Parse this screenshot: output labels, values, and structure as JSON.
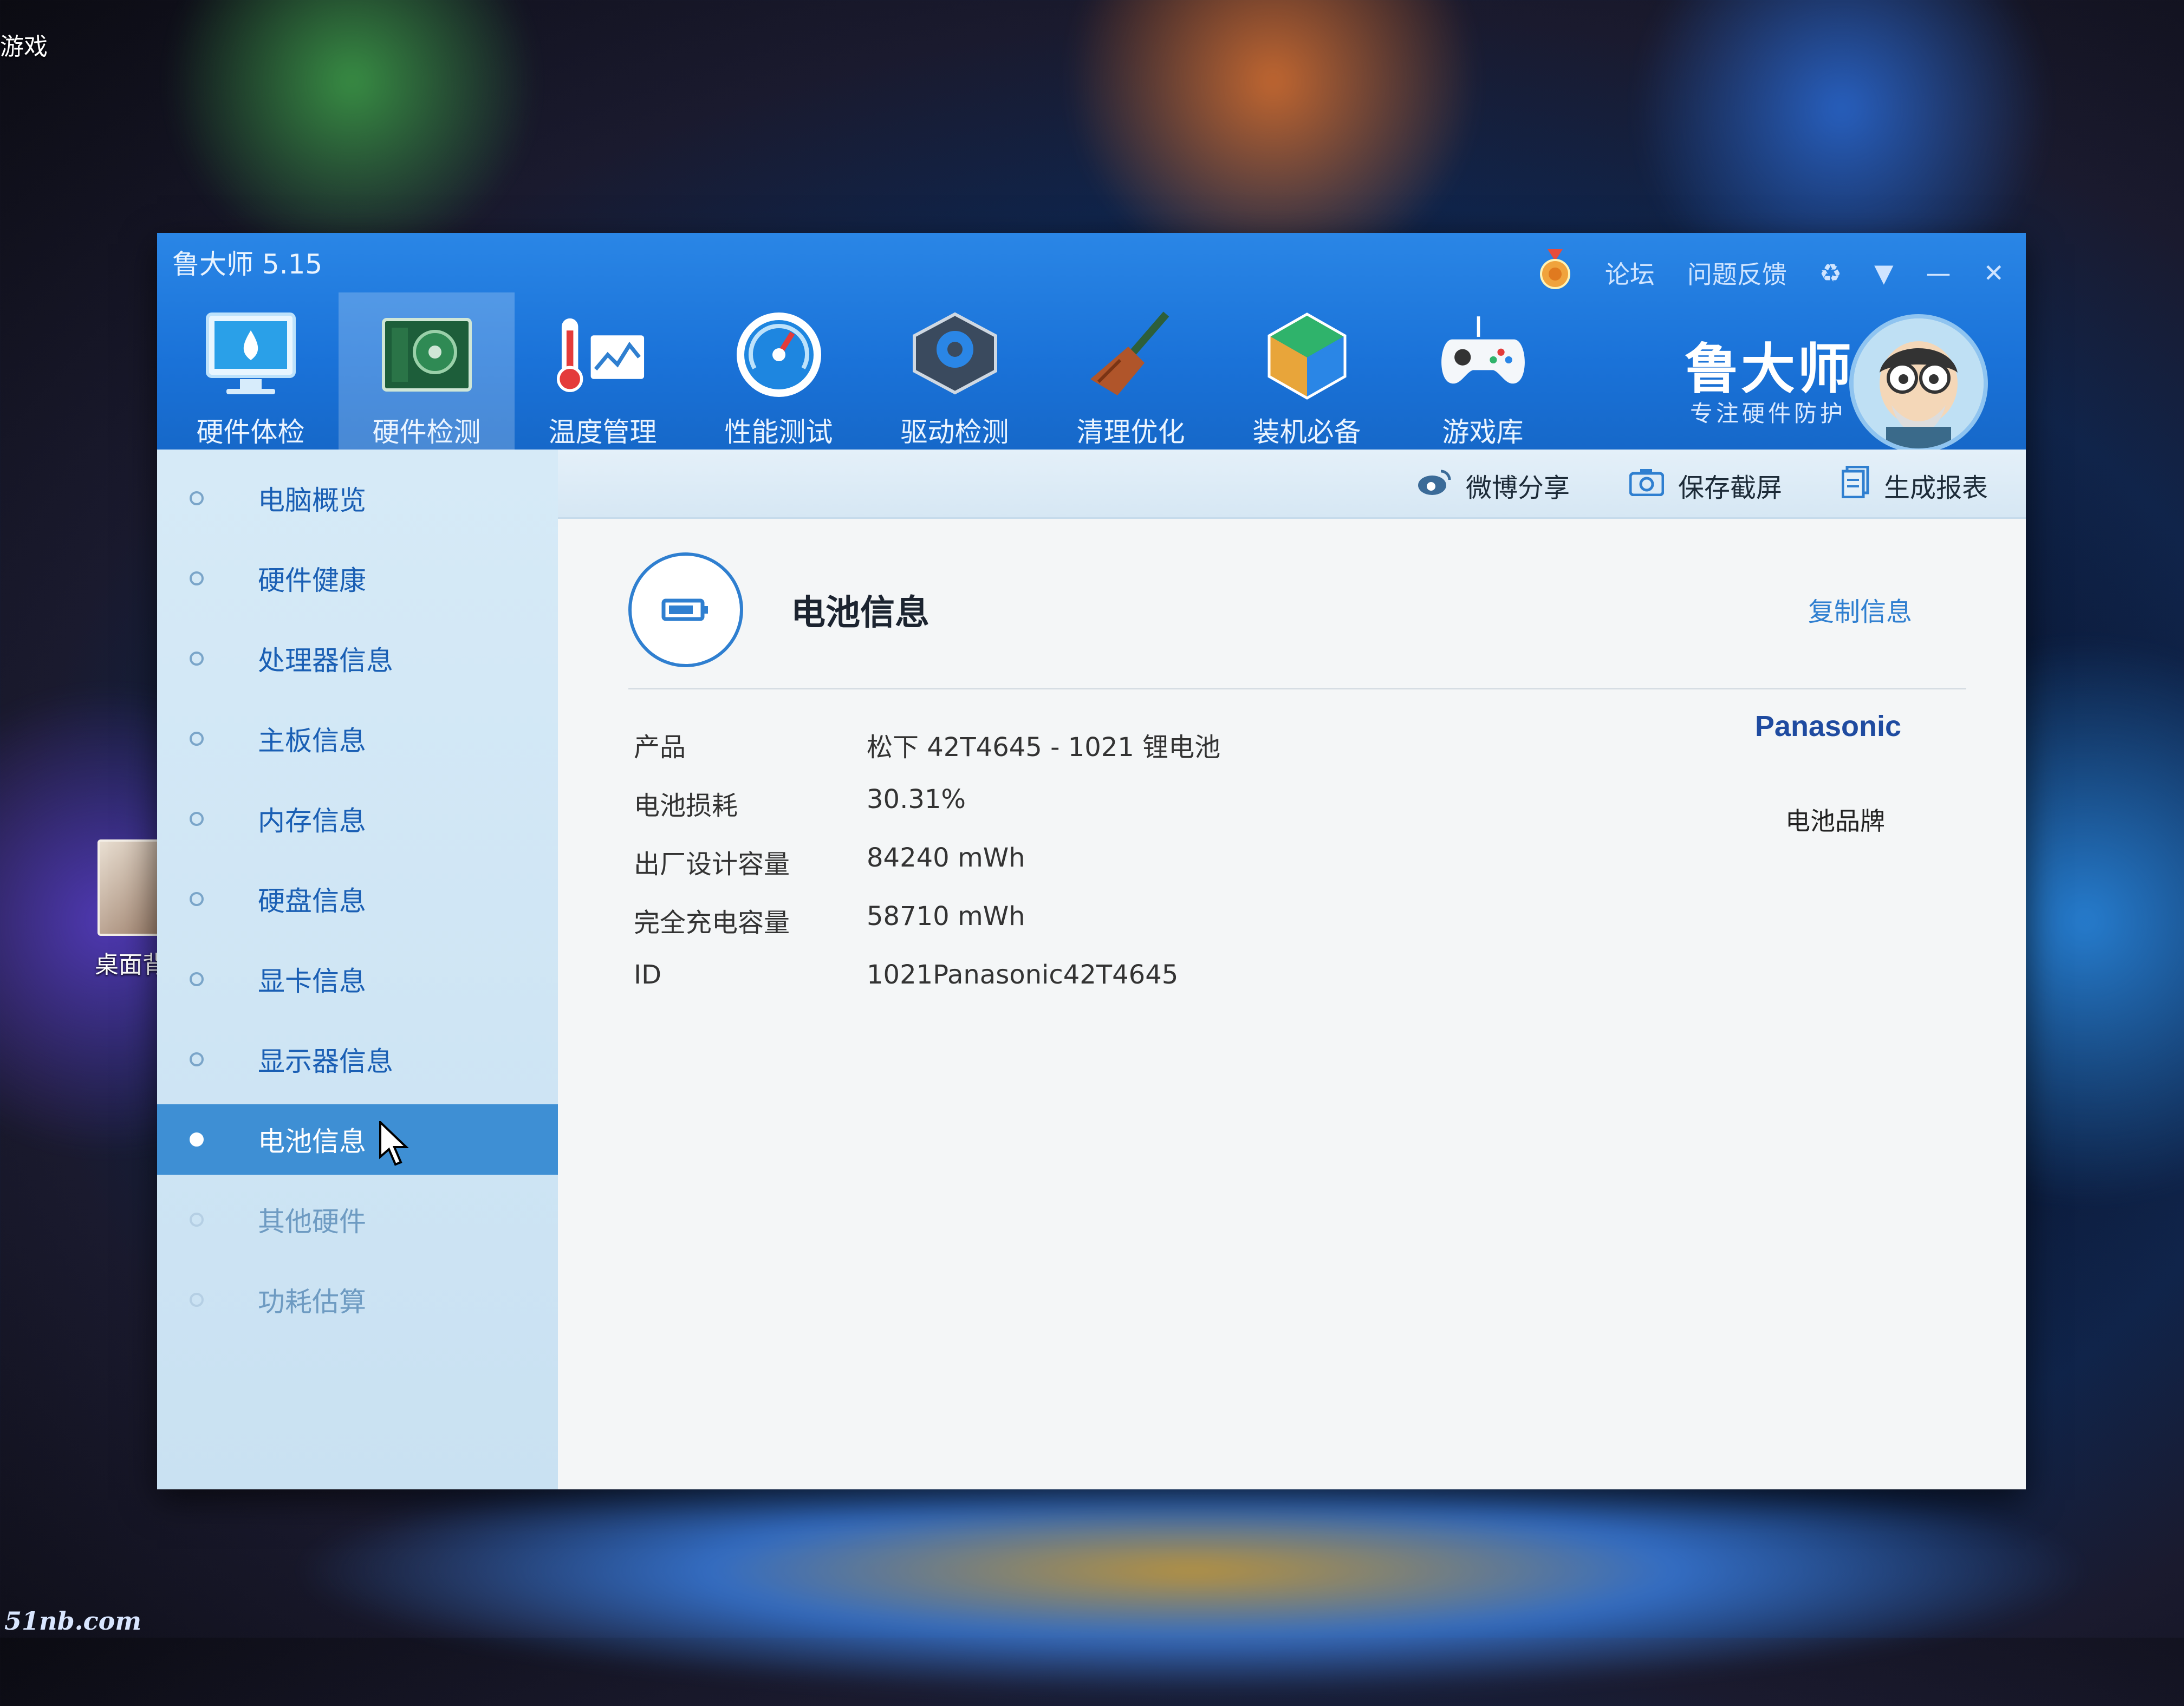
{
  "window": {
    "title": "鲁大师 5.15"
  },
  "top_links": {
    "forum": "论坛",
    "feedback": "问题反馈"
  },
  "nav": [
    {
      "label": "硬件体检",
      "icon": "monitor-icon"
    },
    {
      "label": "硬件检测",
      "icon": "motherboard-icon"
    },
    {
      "label": "温度管理",
      "icon": "thermometer-icon"
    },
    {
      "label": "性能测试",
      "icon": "speedometer-icon"
    },
    {
      "label": "驱动检测",
      "icon": "driver-gear-icon"
    },
    {
      "label": "清理优化",
      "icon": "broom-icon"
    },
    {
      "label": "装机必备",
      "icon": "cube-icon"
    },
    {
      "label": "游戏库",
      "icon": "gamepad-icon"
    }
  ],
  "brand": {
    "name": "鲁大师",
    "slogan": "专注硬件防护"
  },
  "sidebar": [
    {
      "label": "电脑概览"
    },
    {
      "label": "硬件健康"
    },
    {
      "label": "处理器信息"
    },
    {
      "label": "主板信息"
    },
    {
      "label": "内存信息"
    },
    {
      "label": "硬盘信息"
    },
    {
      "label": "显卡信息"
    },
    {
      "label": "显示器信息"
    },
    {
      "label": "电池信息",
      "active": true
    },
    {
      "label": "其他硬件"
    },
    {
      "label": "功耗估算"
    }
  ],
  "toolbar": {
    "share": "微博分享",
    "screenshot": "保存截屏",
    "report": "生成报表"
  },
  "battery": {
    "title": "电池信息",
    "copy": "复制信息",
    "rows": [
      {
        "label": "产品",
        "value": "松下 42T4645 -  1021 锂电池"
      },
      {
        "label": "电池损耗",
        "value": "30.31%"
      },
      {
        "label": "出厂设计容量",
        "value": "84240 mWh"
      },
      {
        "label": "完全充电容量",
        "value": "58710 mWh"
      },
      {
        "label": "ID",
        "value": "1021Panasonic42T4645"
      }
    ],
    "brand_logo_text": "Panasonic",
    "brand_label": "电池品牌"
  },
  "desktop": {
    "label_top": "游戏",
    "label_icon": "桌面背",
    "watermark": "51nb.com"
  },
  "colors": {
    "titlebar": "#1a72d8",
    "accent": "#2f7fd0",
    "sidebar_active": "#3e8fd4"
  }
}
